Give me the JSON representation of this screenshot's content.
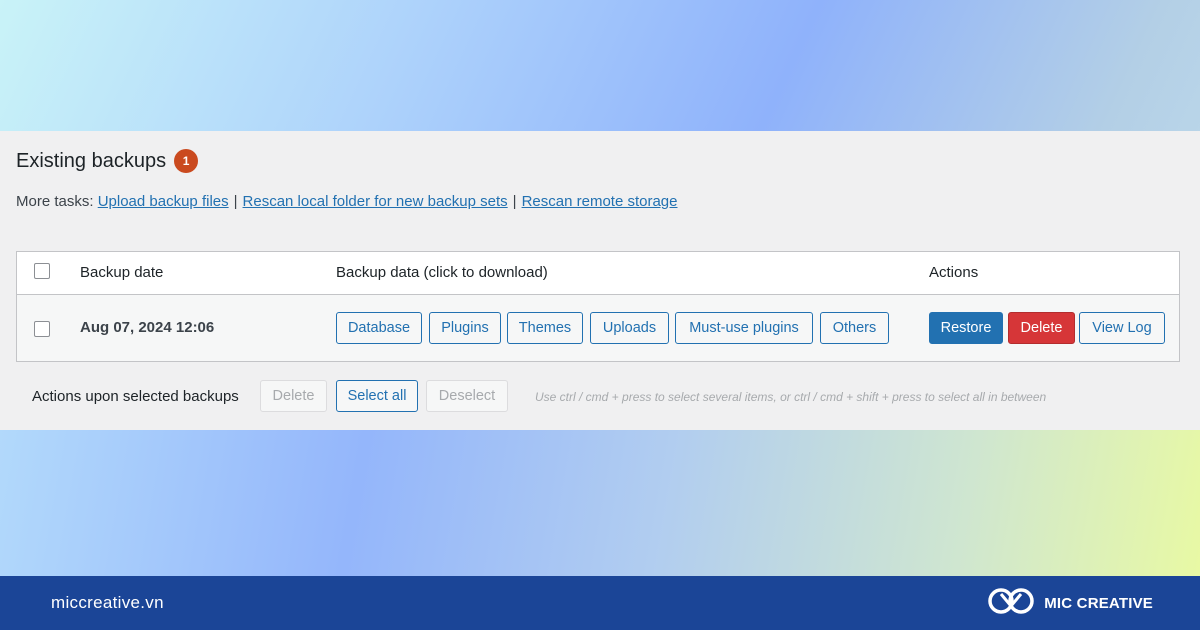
{
  "section": {
    "title": "Existing backups",
    "count": "1"
  },
  "tasks": {
    "prefix": "More tasks:",
    "links": [
      "Upload backup files",
      "Rescan local folder for new backup sets",
      "Rescan remote storage"
    ],
    "separator": "|"
  },
  "table": {
    "headers": {
      "date": "Backup date",
      "data": "Backup data (click to download)",
      "actions": "Actions"
    },
    "rows": [
      {
        "date": "Aug 07, 2024 12:06",
        "downloads": [
          "Database",
          "Plugins",
          "Themes",
          "Uploads",
          "Must-use plugins",
          "Others"
        ],
        "actions": {
          "restore": "Restore",
          "delete": "Delete",
          "view_log": "View Log"
        }
      }
    ]
  },
  "bulk": {
    "label": "Actions upon selected backups",
    "delete": "Delete",
    "select_all": "Select all",
    "deselect": "Deselect",
    "hint": "Use ctrl / cmd + press to select several items, or ctrl / cmd + shift + press to select all in between"
  },
  "footer": {
    "site": "miccreative.vn",
    "brand": "MIC CREATIVE"
  },
  "colors": {
    "accent": "#2271b1",
    "danger": "#d63638",
    "badge": "#ca4a1f",
    "footer_bg": "#1b4597"
  }
}
